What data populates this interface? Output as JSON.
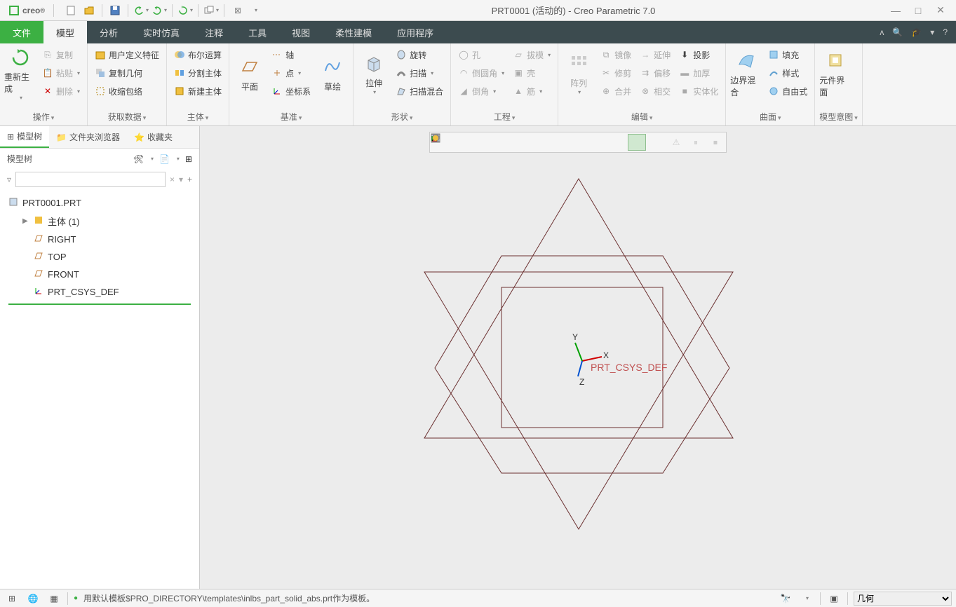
{
  "app": {
    "brand": "creo",
    "title": "PRT0001 (活动的) - Creo Parametric 7.0"
  },
  "win": {
    "min": "—",
    "max": "□",
    "close": "✕"
  },
  "tabs": {
    "file": "文件",
    "items": [
      "模型",
      "分析",
      "实时仿真",
      "注释",
      "工具",
      "视图",
      "柔性建模",
      "应用程序"
    ],
    "active": 0
  },
  "ribbon": {
    "groups": [
      {
        "label": "操作",
        "big": [
          {
            "label": "重新生成",
            "dd": true
          }
        ],
        "small": [
          {
            "label": "复制",
            "disabled": true,
            "ico": "copy"
          },
          {
            "label": "粘贴",
            "disabled": true,
            "ico": "paste",
            "dd": true
          },
          {
            "label": "删除",
            "disabled": true,
            "ico": "delete"
          }
        ]
      },
      {
        "label": "获取数据",
        "small": [
          {
            "label": "用户定义特征",
            "ico": "udf"
          },
          {
            "label": "复制几何",
            "ico": "copygeom"
          },
          {
            "label": "收缩包络",
            "ico": "shrink"
          }
        ]
      },
      {
        "label": "主体",
        "small": [
          {
            "label": "布尔运算",
            "ico": "boolean"
          },
          {
            "label": "分割主体",
            "ico": "split"
          },
          {
            "label": "新建主体",
            "ico": "newbody"
          }
        ]
      },
      {
        "label": "基准",
        "big": [
          {
            "label": "平面",
            "ico": "plane"
          },
          {
            "label": "草绘",
            "ico": "sketch"
          }
        ],
        "small": [
          {
            "label": "轴",
            "ico": "axis"
          },
          {
            "label": "点",
            "ico": "point",
            "dd": true
          },
          {
            "label": "坐标系",
            "ico": "csys"
          }
        ]
      },
      {
        "label": "形状",
        "big": [
          {
            "label": "拉伸",
            "ico": "extrude",
            "dd": true
          }
        ],
        "small": [
          {
            "label": "旋转",
            "ico": "revolve"
          },
          {
            "label": "扫描",
            "ico": "sweep",
            "dd": true
          },
          {
            "label": "扫描混合",
            "ico": "swept"
          }
        ]
      },
      {
        "label": "工程",
        "small2": [
          {
            "label": "孔",
            "ico": "hole",
            "disabled": true
          },
          {
            "label": "拔模",
            "ico": "draft",
            "disabled": true,
            "dd": true
          },
          {
            "label": "倒圆角",
            "ico": "round",
            "disabled": true,
            "dd": true
          },
          {
            "label": "壳",
            "ico": "shell",
            "disabled": true
          },
          {
            "label": "倒角",
            "ico": "chamfer",
            "disabled": true,
            "dd": true
          },
          {
            "label": "筋",
            "ico": "rib",
            "disabled": true,
            "dd": true
          }
        ]
      },
      {
        "label": "编辑",
        "big": [
          {
            "label": "阵列",
            "ico": "pattern",
            "disabled": true,
            "dd": true
          }
        ],
        "small3": [
          {
            "label": "镜像",
            "ico": "mirror",
            "disabled": true
          },
          {
            "label": "延伸",
            "ico": "extend",
            "disabled": true
          },
          {
            "label": "投影",
            "ico": "project"
          },
          {
            "label": "修剪",
            "ico": "trim",
            "disabled": true
          },
          {
            "label": "偏移",
            "ico": "offset",
            "disabled": true
          },
          {
            "label": "加厚",
            "ico": "thicken",
            "disabled": true
          },
          {
            "label": "合并",
            "ico": "merge",
            "disabled": true
          },
          {
            "label": "相交",
            "ico": "intersect",
            "disabled": true
          },
          {
            "label": "实体化",
            "ico": "solidify",
            "disabled": true
          }
        ]
      },
      {
        "label": "曲面",
        "big": [
          {
            "label": "边界混合",
            "ico": "boundary"
          }
        ],
        "small": [
          {
            "label": "填充",
            "ico": "fill"
          },
          {
            "label": "样式",
            "ico": "style"
          },
          {
            "label": "自由式",
            "ico": "freestyle"
          }
        ]
      },
      {
        "label": "模型意图",
        "big": [
          {
            "label": "元件界面",
            "ico": "component"
          }
        ]
      }
    ]
  },
  "sidebar": {
    "tabs": [
      {
        "label": "模型树",
        "active": true
      },
      {
        "label": "文件夹浏览器"
      },
      {
        "label": "收藏夹"
      }
    ],
    "tree_label": "模型树",
    "root": "PRT0001.PRT",
    "items": [
      {
        "label": "主体 (1)",
        "ico": "body",
        "exp": true
      },
      {
        "label": "RIGHT",
        "ico": "plane"
      },
      {
        "label": "TOP",
        "ico": "plane"
      },
      {
        "label": "FRONT",
        "ico": "plane"
      },
      {
        "label": "PRT_CSYS_DEF",
        "ico": "csys"
      }
    ]
  },
  "canvas": {
    "csys_label": "PRT_CSYS_DEF",
    "axes": {
      "x": "X",
      "y": "Y",
      "z": "Z"
    }
  },
  "statusbar": {
    "message": "用默认模板$PRO_DIRECTORY\\templates\\inlbs_part_solid_abs.prt作为模板。",
    "filter": "几何"
  }
}
